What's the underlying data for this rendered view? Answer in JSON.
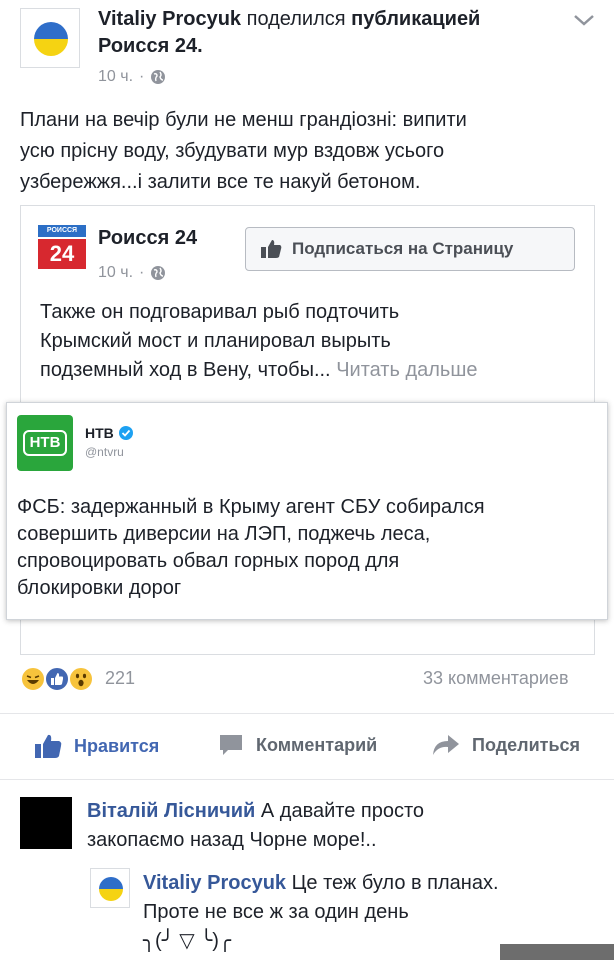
{
  "post": {
    "author": "Vitaliy Procyuk",
    "shared_text": "поделился",
    "shared_object": "публикацией",
    "source": "Роисся 24.",
    "time": "10 ч.",
    "body_lines": [
      "Плани на вечір були не менш грандіозні: випити",
      "усю прісну воду, збудувати мур вздовж усього",
      "узбережжя...і залити все те накуй бетоном."
    ]
  },
  "shared_page": {
    "logo_top": "РОИССЯ",
    "logo_num": "24",
    "name": "Роисся 24",
    "time": "10 ч.",
    "subscribe_label": "Подписаться на Страницу",
    "body_lines": [
      "Также он подговаривал рыб подточить",
      "Крымский мост и планировал вырыть",
      "подземный ход в Вену, чтобы..."
    ],
    "read_more": "Читать дальше"
  },
  "tweet": {
    "logo_text": "НТВ",
    "name": "НТВ",
    "handle": "@ntvru",
    "body_lines": [
      "ФСБ: задержанный в Крыму агент СБУ собирался",
      "совершить диверсии на ЛЭП, поджечь леса,",
      "спровоцировать обвал горных пород для",
      "блокировки дорог"
    ]
  },
  "stats": {
    "reactions_count": "221",
    "comments_count": "33 комментариев"
  },
  "actions": {
    "like": "Нравится",
    "comment": "Комментарий",
    "share": "Поделиться"
  },
  "comments": [
    {
      "author": "Віталій Лісничий",
      "lines": [
        "А давайте просто",
        "закопаємо назад Чорне море!.."
      ]
    },
    {
      "author": "Vitaliy Procyuk",
      "lines": [
        "Це теж було в планах.",
        "Проте не все ж за один день",
        "╮(╯ ▽ ╰)╭"
      ]
    }
  ],
  "colors": {
    "fb_blue": "#4267b2",
    "link_blue": "#365899",
    "ntv_green": "#2aa63c",
    "rossiya_red": "#d7282f"
  }
}
